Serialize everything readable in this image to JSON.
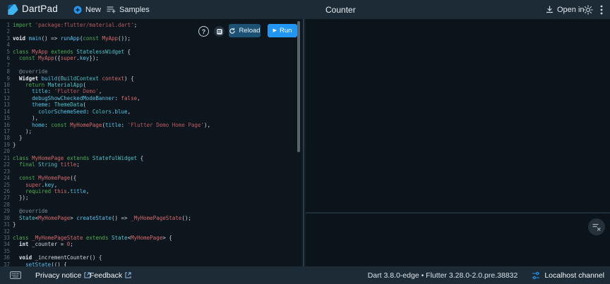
{
  "header": {
    "app_title": "DartPad",
    "new_label": "New",
    "samples_label": "Samples",
    "page_title": "Counter",
    "open_in_label": "Open in"
  },
  "editor": {
    "help_glyph": "?",
    "reload_label": "Reload",
    "run_label": "Run",
    "run_glyph": "▶",
    "lines": [
      [
        [
          "kw",
          "import"
        ],
        [
          "pl",
          " "
        ],
        [
          "str",
          "'package:flutter/material.dart'"
        ],
        [
          "pl",
          ";"
        ]
      ],
      [],
      [
        [
          "kwb",
          "void"
        ],
        [
          "pl",
          " "
        ],
        [
          "fn",
          "main"
        ],
        [
          "pl",
          "() => "
        ],
        [
          "fn",
          "runApp"
        ],
        [
          "pl",
          "("
        ],
        [
          "kw",
          "const"
        ],
        [
          "pl",
          " "
        ],
        [
          "id",
          "MyApp"
        ],
        [
          "pl",
          "());"
        ]
      ],
      [],
      [
        [
          "kw",
          "class"
        ],
        [
          "pl",
          " "
        ],
        [
          "id",
          "MyApp"
        ],
        [
          "pl",
          " "
        ],
        [
          "kw",
          "extends"
        ],
        [
          "pl",
          " "
        ],
        [
          "ty",
          "StatelessWidget"
        ],
        [
          "pl",
          " {"
        ]
      ],
      [
        [
          "pl",
          "  "
        ],
        [
          "kw",
          "const"
        ],
        [
          "pl",
          " "
        ],
        [
          "id",
          "MyApp"
        ],
        [
          "pl",
          "({"
        ],
        [
          "id",
          "super"
        ],
        [
          "pl",
          "."
        ],
        [
          "prop",
          "key"
        ],
        [
          "pl",
          "});"
        ]
      ],
      [],
      [
        [
          "pl",
          "  "
        ],
        [
          "cm",
          "@override"
        ]
      ],
      [
        [
          "pl",
          "  "
        ],
        [
          "kwb",
          "Widget"
        ],
        [
          "pl",
          " "
        ],
        [
          "fn",
          "build"
        ],
        [
          "pl",
          "("
        ],
        [
          "ty",
          "BuildContext"
        ],
        [
          "pl",
          " "
        ],
        [
          "id",
          "context"
        ],
        [
          "pl",
          ") {"
        ]
      ],
      [
        [
          "pl",
          "    "
        ],
        [
          "kw",
          "return"
        ],
        [
          "pl",
          " "
        ],
        [
          "ty",
          "MaterialApp"
        ],
        [
          "pl",
          "("
        ]
      ],
      [
        [
          "pl",
          "      "
        ],
        [
          "prop",
          "title"
        ],
        [
          "pl",
          ": "
        ],
        [
          "str",
          "'Flutter Demo'"
        ],
        [
          "pl",
          ","
        ]
      ],
      [
        [
          "pl",
          "      "
        ],
        [
          "prop",
          "debugShowCheckedModeBanner"
        ],
        [
          "pl",
          ": "
        ],
        [
          "num",
          "false"
        ],
        [
          "pl",
          ","
        ]
      ],
      [
        [
          "pl",
          "      "
        ],
        [
          "prop",
          "theme"
        ],
        [
          "pl",
          ": "
        ],
        [
          "ty",
          "ThemeData"
        ],
        [
          "pl",
          "("
        ]
      ],
      [
        [
          "pl",
          "        "
        ],
        [
          "prop",
          "colorSchemeSeed"
        ],
        [
          "pl",
          ": "
        ],
        [
          "ty",
          "Colors"
        ],
        [
          "pl",
          "."
        ],
        [
          "prop",
          "blue"
        ],
        [
          "pl",
          ","
        ]
      ],
      [
        [
          "pl",
          "      ),"
        ]
      ],
      [
        [
          "pl",
          "      "
        ],
        [
          "prop",
          "home"
        ],
        [
          "pl",
          ": "
        ],
        [
          "kw",
          "const"
        ],
        [
          "pl",
          " "
        ],
        [
          "id",
          "MyHomePage"
        ],
        [
          "pl",
          "("
        ],
        [
          "prop",
          "title"
        ],
        [
          "pl",
          ": "
        ],
        [
          "str",
          "'Flutter Demo Home Page'"
        ],
        [
          "pl",
          "),"
        ]
      ],
      [
        [
          "pl",
          "    );"
        ]
      ],
      [
        [
          "pl",
          "  }"
        ]
      ],
      [
        [
          "pl",
          "}"
        ]
      ],
      [],
      [
        [
          "kw",
          "class"
        ],
        [
          "pl",
          " "
        ],
        [
          "id",
          "MyHomePage"
        ],
        [
          "pl",
          " "
        ],
        [
          "kw",
          "extends"
        ],
        [
          "pl",
          " "
        ],
        [
          "ty",
          "StatefulWidget"
        ],
        [
          "pl",
          " {"
        ]
      ],
      [
        [
          "pl",
          "  "
        ],
        [
          "kw",
          "final"
        ],
        [
          "pl",
          " "
        ],
        [
          "ty",
          "String"
        ],
        [
          "pl",
          " "
        ],
        [
          "id",
          "title"
        ],
        [
          "pl",
          ";"
        ]
      ],
      [],
      [
        [
          "pl",
          "  "
        ],
        [
          "kw",
          "const"
        ],
        [
          "pl",
          " "
        ],
        [
          "id",
          "MyHomePage"
        ],
        [
          "pl",
          "({"
        ]
      ],
      [
        [
          "pl",
          "    "
        ],
        [
          "id",
          "super"
        ],
        [
          "pl",
          "."
        ],
        [
          "prop",
          "key"
        ],
        [
          "pl",
          ","
        ]
      ],
      [
        [
          "pl",
          "    "
        ],
        [
          "kw",
          "required"
        ],
        [
          "pl",
          " "
        ],
        [
          "id",
          "this"
        ],
        [
          "pl",
          "."
        ],
        [
          "prop",
          "title"
        ],
        [
          "pl",
          ","
        ]
      ],
      [
        [
          "pl",
          "  });"
        ]
      ],
      [],
      [
        [
          "pl",
          "  "
        ],
        [
          "cm",
          "@override"
        ]
      ],
      [
        [
          "pl",
          "  "
        ],
        [
          "ty",
          "State"
        ],
        [
          "pl",
          "<"
        ],
        [
          "id",
          "MyHomePage"
        ],
        [
          "pl",
          "> "
        ],
        [
          "fn",
          "createState"
        ],
        [
          "pl",
          "() => "
        ],
        [
          "id",
          "_MyHomePageState"
        ],
        [
          "pl",
          "();"
        ]
      ],
      [
        [
          "pl",
          "}"
        ]
      ],
      [],
      [
        [
          "kw",
          "class"
        ],
        [
          "pl",
          " "
        ],
        [
          "id",
          "_MyHomePageState"
        ],
        [
          "pl",
          " "
        ],
        [
          "kw",
          "extends"
        ],
        [
          "pl",
          " "
        ],
        [
          "ty",
          "State"
        ],
        [
          "pl",
          "<"
        ],
        [
          "id",
          "MyHomePage"
        ],
        [
          "pl",
          "> {"
        ]
      ],
      [
        [
          "pl",
          "  "
        ],
        [
          "kwb",
          "int"
        ],
        [
          "pl",
          " _counter = "
        ],
        [
          "num",
          "0"
        ],
        [
          "pl",
          ";"
        ]
      ],
      [],
      [
        [
          "pl",
          "  "
        ],
        [
          "kwb",
          "void"
        ],
        [
          "pl",
          " _incrementCounter() {"
        ]
      ],
      [
        [
          "pl",
          "    "
        ],
        [
          "fn",
          "setState"
        ],
        [
          "pl",
          "(() {"
        ]
      ]
    ]
  },
  "footer": {
    "privacy_label": "Privacy notice",
    "feedback_label": "Feedback",
    "version_text": "Dart 3.8.0-edge • Flutter 3.28.0-2.0.pre.38832",
    "channel_label": "Localhost channel"
  },
  "colors": {
    "accent_blue": "#2196f3",
    "header_bg": "#1d2b36",
    "editor_bg": "#0d161d",
    "panel_bg": "#0b141b",
    "reload_bg": "#1c5173"
  }
}
